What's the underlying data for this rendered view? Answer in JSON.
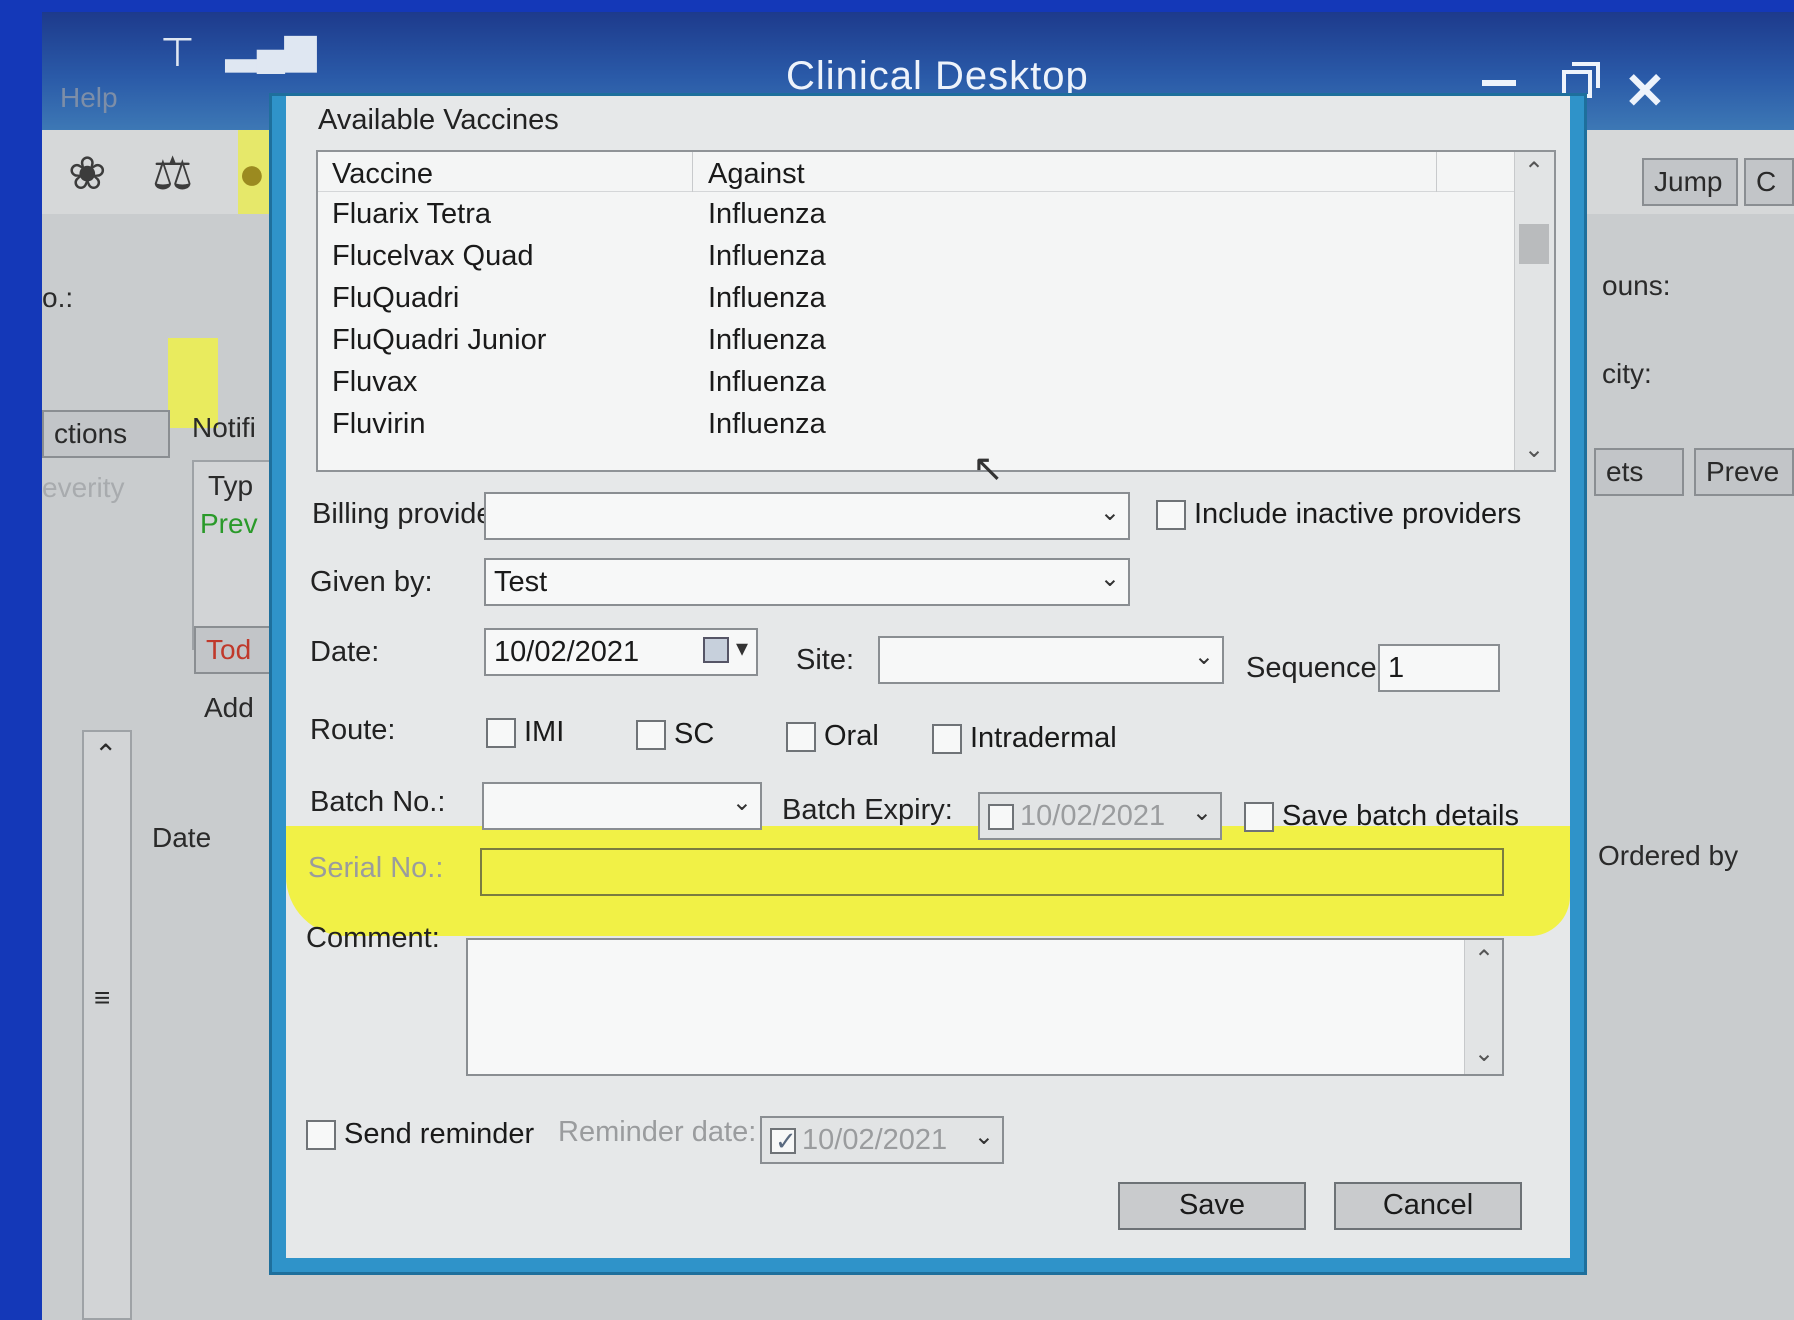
{
  "window": {
    "title": "Clinical Desktop",
    "menu_help": "Help"
  },
  "background": {
    "left_labels": {
      "no": "o.:",
      "actions": "ctions",
      "notifications": "Notifi",
      "severity": "everity",
      "type": "Typ",
      "prev": "Prev",
      "today": "Tod",
      "add": "Add",
      "date_col": "Date"
    },
    "right_labels": {
      "jump": "Jump",
      "c": "C",
      "counts": "ouns:",
      "city": "city:",
      "sets": "ets",
      "prev": "Preve",
      "ordered_by": "Ordered by"
    }
  },
  "dialog": {
    "group_title": "Available Vaccines",
    "columns": [
      "Vaccine",
      "Against"
    ],
    "vaccines": [
      {
        "name": "Fluarix Tetra",
        "against": "Influenza"
      },
      {
        "name": "Flucelvax Quad",
        "against": "Influenza"
      },
      {
        "name": "FluQuadri",
        "against": "Influenza"
      },
      {
        "name": "FluQuadri Junior",
        "against": "Influenza"
      },
      {
        "name": "Fluvax",
        "against": "Influenza"
      },
      {
        "name": "Fluvirin",
        "against": "Influenza"
      }
    ],
    "billing_provider": {
      "label": "Billing provider:",
      "value": ""
    },
    "include_inactive": {
      "label": "Include inactive providers",
      "checked": false
    },
    "given_by": {
      "label": "Given by:",
      "value": "Test"
    },
    "date": {
      "label": "Date:",
      "value": "10/02/2021"
    },
    "site": {
      "label": "Site:",
      "value": ""
    },
    "sequence": {
      "label": "Sequence:",
      "value": "1"
    },
    "route": {
      "label": "Route:",
      "options": [
        {
          "label": "IMI",
          "checked": false
        },
        {
          "label": "SC",
          "checked": false
        },
        {
          "label": "Oral",
          "checked": false
        },
        {
          "label": "Intradermal",
          "checked": false
        }
      ]
    },
    "batch_no": {
      "label": "Batch No.:",
      "value": ""
    },
    "batch_expiry": {
      "label": "Batch Expiry:",
      "value": "10/02/2021",
      "checked": false
    },
    "save_batch": {
      "label": "Save batch details",
      "checked": false
    },
    "serial_no": {
      "label": "Serial No.:",
      "value": ""
    },
    "comment": {
      "label": "Comment:",
      "value": ""
    },
    "send_reminder": {
      "label": "Send reminder",
      "checked": false
    },
    "reminder_date": {
      "label": "Reminder date:",
      "value": "10/02/2021",
      "checked": true
    },
    "save_label": "Save",
    "cancel_label": "Cancel"
  },
  "colors": {
    "title_bar": "#2a5aa8",
    "dialog_border": "#2f93c9",
    "highlight": "#f3f418",
    "backdrop": "#1438b8"
  }
}
